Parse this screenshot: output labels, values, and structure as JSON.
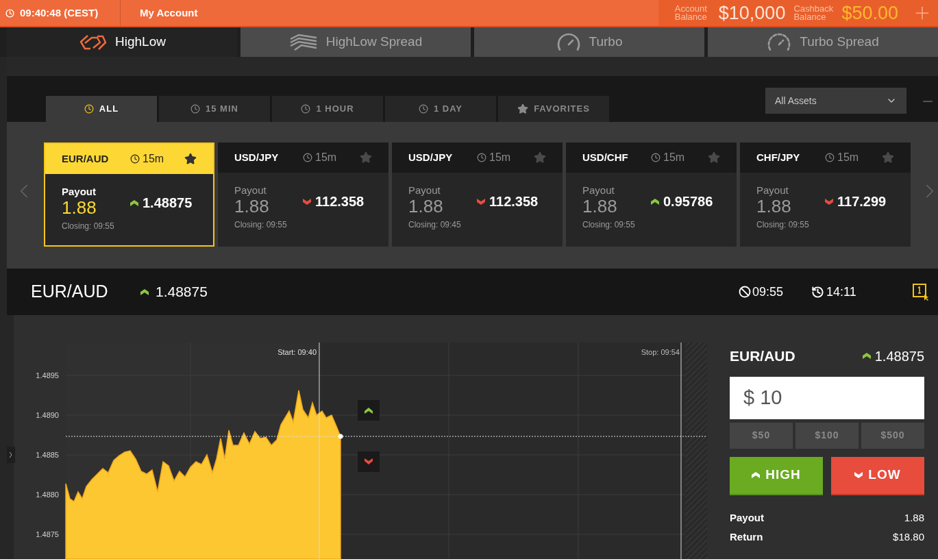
{
  "top_bar": {
    "clock": "09:40:48 (CEST)",
    "my_account": "My Account",
    "account_balance_label": "Account Balance",
    "account_balance": "$10,000",
    "cashback_label": "Cashback Balance",
    "cashback": "$50.00"
  },
  "product_tabs": [
    {
      "label": "HighLow",
      "kind": "highlow",
      "selected": true
    },
    {
      "label": "HighLow Spread",
      "kind": "spread",
      "selected": false
    },
    {
      "label": "Turbo",
      "kind": "turbo",
      "selected": false
    },
    {
      "label": "Turbo Spread",
      "kind": "turbospread",
      "selected": false
    }
  ],
  "period_tabs": [
    {
      "label": "ALL",
      "kind": "clock",
      "selected": true
    },
    {
      "label": "15 MIN",
      "kind": "clock",
      "selected": false
    },
    {
      "label": "1 HOUR",
      "kind": "clock",
      "selected": false
    },
    {
      "label": "1 DAY",
      "kind": "clock",
      "selected": false
    },
    {
      "label": "FAVORITES",
      "kind": "star",
      "selected": false
    }
  ],
  "asset_filter": {
    "value": "All Assets"
  },
  "assets": [
    {
      "pair": "EUR/AUD",
      "duration": "15m",
      "payout_label": "Payout",
      "payout": "1.88",
      "rising": true,
      "price": "1.48875",
      "closing": "Closing: 09:55",
      "selected": true
    },
    {
      "pair": "USD/JPY",
      "duration": "15m",
      "payout_label": "Payout",
      "payout": "1.88",
      "rising": false,
      "price": "112.358",
      "closing": "Closing: 09:55",
      "selected": false
    },
    {
      "pair": "USD/JPY",
      "duration": "15m",
      "payout_label": "Payout",
      "payout": "1.88",
      "rising": false,
      "price": "112.358",
      "closing": "Closing: 09:45",
      "selected": false
    },
    {
      "pair": "USD/CHF",
      "duration": "15m",
      "payout_label": "Payout",
      "payout": "1.88",
      "rising": true,
      "price": "0.95786",
      "closing": "Closing: 09:55",
      "selected": false
    },
    {
      "pair": "CHF/JPY",
      "duration": "15m",
      "payout_label": "Payout",
      "payout": "1.88",
      "rising": false,
      "price": "117.299",
      "closing": "Closing: 09:55",
      "selected": false
    }
  ],
  "selected_asset": {
    "pair": "EUR/AUD",
    "rising": true,
    "price": "1.48875",
    "expiry": "09:55",
    "remaining": "14:11"
  },
  "chart": {
    "y_labels": [
      "1.4895",
      "1.4890",
      "1.4885",
      "1.4880",
      "1.4875"
    ],
    "start_label": "Start: 09:40",
    "stop_label": "Stop: 09:54"
  },
  "trade_panel": {
    "pair": "EUR/AUD",
    "rising": true,
    "price": "1.48875",
    "amount": "$ 10",
    "presets": [
      "$50",
      "$100",
      "$500"
    ],
    "high_label": "HIGH",
    "low_label": "LOW",
    "payout_label": "Payout",
    "payout": "1.88",
    "return_label": "Return",
    "return": "$18.80"
  }
}
